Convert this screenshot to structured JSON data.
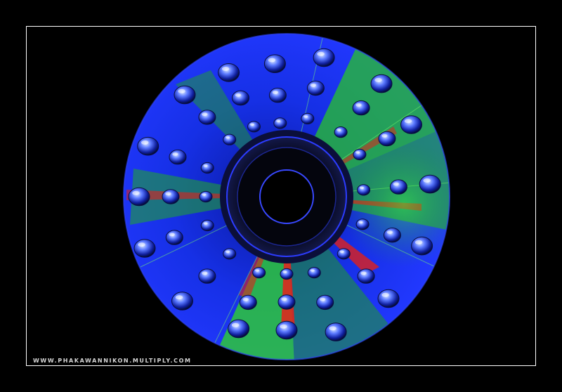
{
  "photo": {
    "subject": "compact-disc-with-water-droplets",
    "colors": {
      "background": "#000000",
      "frame": "#ffffff",
      "disc_blue": "#1a2cff",
      "disc_green": "#2fd12b",
      "disc_red": "#e0201a",
      "hub_dark": "#05060f"
    }
  },
  "watermark": {
    "text": "WWW.PHAKAWANNIKON.MULTIPLY.COM"
  }
}
